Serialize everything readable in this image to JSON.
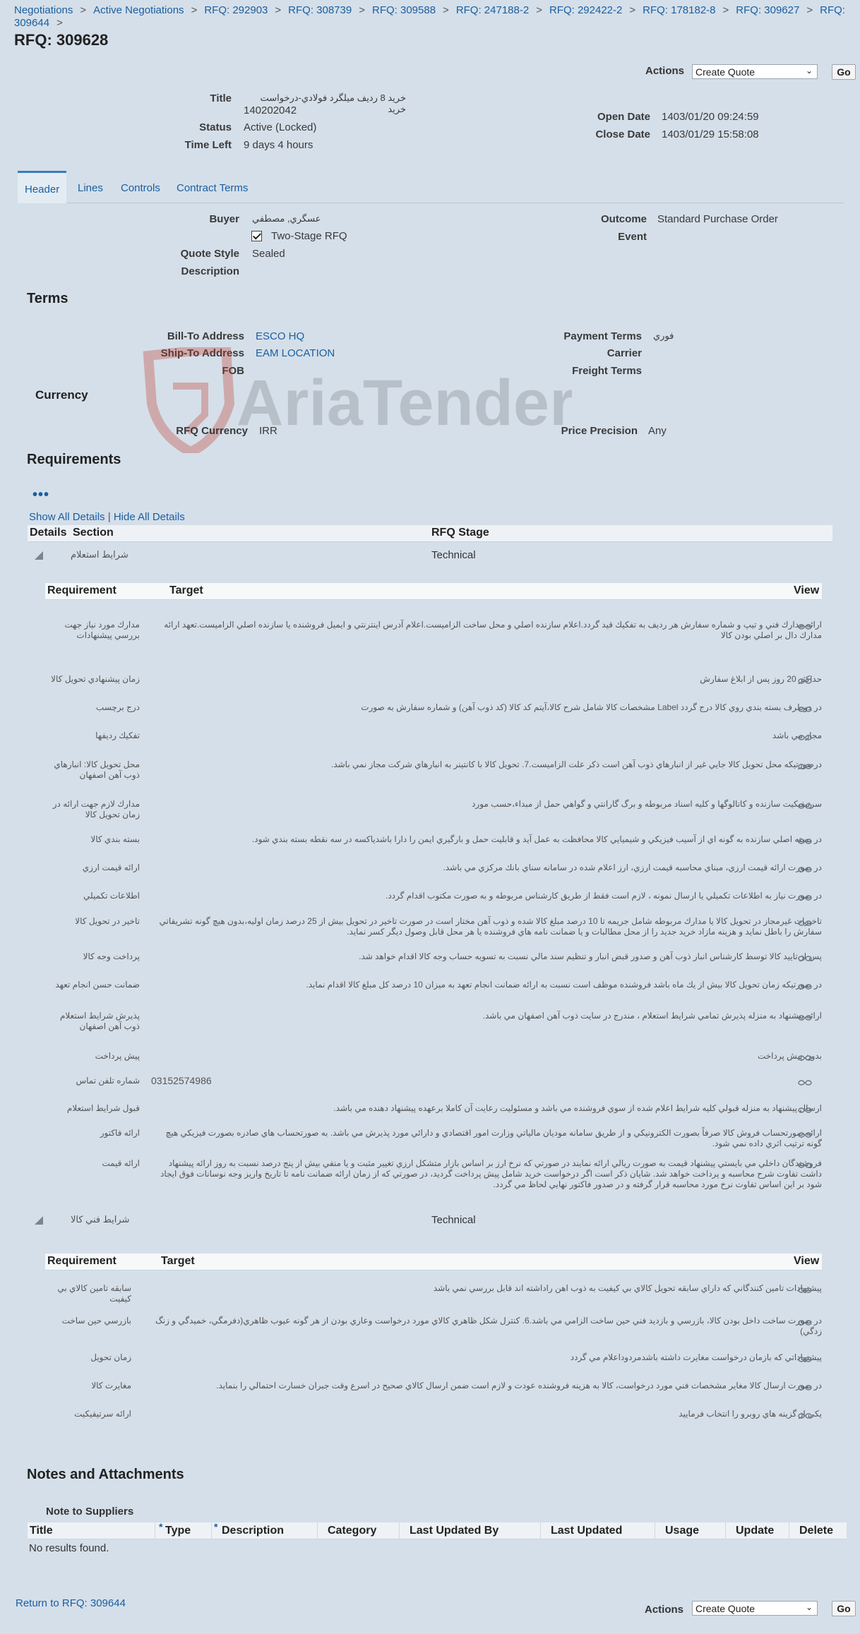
{
  "breadcrumbs": [
    "Negotiations",
    "Active Negotiations",
    "RFQ: 292903",
    "RFQ: 308739",
    "RFQ: 309588",
    "RFQ: 247188-2",
    "RFQ: 292422-2",
    "RFQ: 178182-8",
    "RFQ: 309627",
    "RFQ: 309644"
  ],
  "page_title": "RFQ: 309628",
  "actions": {
    "label": "Actions",
    "selected": "Create Quote",
    "go": "Go"
  },
  "summary": {
    "title_label": "Title",
    "title_value_line1": "خريد 8 رديف ميلگرد فولادي-درخواست خريد",
    "title_value_line2": "140202042",
    "status_label": "Status",
    "status_value": "Active (Locked)",
    "time_left_label": "Time Left",
    "time_left_value": "9 days 4 hours",
    "open_date_label": "Open Date",
    "open_date_value": "1403/01/20 09:24:59",
    "close_date_label": "Close Date",
    "close_date_value": "1403/01/29 15:58:08"
  },
  "tabs": [
    "Header",
    "Lines",
    "Controls",
    "Contract Terms"
  ],
  "header": {
    "buyer_label": "Buyer",
    "buyer_value": "عسگري, مصطفي",
    "two_stage_label": "Two-Stage RFQ",
    "quote_style_label": "Quote Style",
    "quote_style_value": "Sealed",
    "description_label": "Description",
    "outcome_label": "Outcome",
    "outcome_value": "Standard Purchase Order",
    "event_label": "Event"
  },
  "terms": {
    "heading": "Terms",
    "bill_to_label": "Bill-To Address",
    "bill_to_value": "ESCO HQ",
    "ship_to_label": "Ship-To Address",
    "ship_to_value": "EAM LOCATION",
    "fob_label": "FOB",
    "payment_terms_label": "Payment Terms",
    "payment_terms_value": "فوري",
    "carrier_label": "Carrier",
    "freight_terms_label": "Freight Terms"
  },
  "currency": {
    "heading": "Currency",
    "rfq_currency_label": "RFQ Currency",
    "rfq_currency_value": "IRR",
    "price_precision_label": "Price Precision",
    "price_precision_value": "Any"
  },
  "watermark_text": "AriaTender.neT",
  "requirements": {
    "heading": "Requirements",
    "show_all": "Show All Details",
    "divider": "|",
    "hide_all": "Hide All Details",
    "col_details": "Details",
    "col_section": "Section",
    "col_stage": "RFQ Stage",
    "col_requirement": "Requirement",
    "col_target": "Target",
    "col_view": "View",
    "sections": [
      {
        "name": "شرايط استعلام",
        "stage": "Technical",
        "rows": [
          {
            "req": "مدارك مورد نياز جهت بررسي پيشنهادات",
            "target": "ارائه مدارك فني و تيپ و شماره سفارش هر رديف به تفكيك قيد گردد.اعلام سازنده اصلي و محل ساخت الزاميست.اعلام آدرس اينترنتي و ايميل فروشنده يا سازنده اصلي الزاميست.تعهد ارائه مدارك دال بر اصلي بودن كالا"
          },
          {
            "req": "زمان پيشنهادي تحويل كالا",
            "target": "حداكثر 20 روز پس از ابلاغ سفارش"
          },
          {
            "req": "درج برچسب",
            "target": "در دوطرف بسته بندي روي كالا درج گردد Label مشخصات كالا شامل شرح كالا،آيتم كد كالا (كد ذوب آهن) و شماره سفارش به صورت"
          },
          {
            "req": "تفكيك رديفها",
            "target": "مجاز مي باشد"
          },
          {
            "req": "محل تحويل كالا: انبارهاي ذوب آهن اصفهان",
            "target": "درصورتيكه محل تحويل كالا جايي غير از انبارهاي ذوب آهن است ذكر علت الزاميست.7. تحويل كالا با كانتينر به انبارهاي شركت مجاز نمي باشد."
          },
          {
            "req": "مدارك لازم جهت ارائه در زمان تحويل كالا",
            "target": "سرتيفيكيت سازنده و كاتالوگها و كليه اسناد مربوطه و برگ گارانتي و گواهي حمل از مبداء،حسب مورد"
          },
          {
            "req": "بسته بندي كالا",
            "target": "در بسته اصلي سازنده به گونه اي از آسيب فيزيكي و شيميايي كالا محافظت به عمل آيد و قابليت حمل و بارگيري ايمن را دارا باشدياكسه در سه نقطه بسته بندي شود."
          },
          {
            "req": "ارائه قيمت ارزي",
            "target": "در صورت ارائه قيمت ارزي، مبناي محاسبه قيمت ارزي، ارز اعلام شده در سامانه سناي بانك مركزي مي باشد."
          },
          {
            "req": "اطلاعات تكميلي",
            "target": "در صورت نياز به اطلاعات تكميلي يا ارسال نمونه ، لازم است فقط از طريق كارشناس مربوطه و به صورت مكتوب اقدام گردد."
          },
          {
            "req": "تاخير در تحويل كالا",
            "target": "تاخيرات غيرمجاز در تحويل كالا يا مدارك مربوطه شامل جريمه تا 10 درصد مبلغ كالا شده و ذوب آهن مختار است در صورت تاخير در تحويل بيش از 25 درصد زمان اوليه،بدون هيچ گونه تشريفاتي سفارش را باطل نمايد و هزينه مازاد خريد جديد را از محل مطالبات و يا ضمانت نامه هاي فروشنده يا هر محل قابل وصول ديگر كسر نمايد."
          },
          {
            "req": "پرداخت وجه كالا",
            "target": "پس از تاييد كالا توسط كارشناس انبار ذوب آهن و صدور قبض انبار و تنظيم سند مالي نسبت به تسويه حساب وجه كالا اقدام خواهد شد."
          },
          {
            "req": "ضمانت حسن انجام تعهد",
            "target": "در صورتيكه زمان تحويل كالا بيش از يك ماه باشد فروشنده موظف است نسبت به ارائه ضمانت انجام تعهد به ميزان 10 درصد كل مبلغ كالا اقدام نمايد."
          },
          {
            "req": "پذيرش شرايط استعلام ذوب آهن اصفهان",
            "target": "ارائه پيشنهاد به منزله پذيرش تمامي شرايط استعلام ، مندرج در سايت ذوب آهن اصفهان مي باشد."
          },
          {
            "req": "پيش پرداخت",
            "target": "بدون پيش پرداخت"
          },
          {
            "req": "شماره تلفن تماس",
            "target": "03152574986"
          },
          {
            "req": "قبول شرايط استعلام",
            "target": "ارسال پيشنهاد به منزله قبولي كليه شرايط اعلام شده از سوي فروشنده مي باشد و مسئوليت رعايت آن كاملا برعهده پيشنهاد دهنده مي باشد."
          },
          {
            "req": "ارائه فاكتور",
            "target": "ارائه صورتحساب فروش كالا صرفاً بصورت الكترونيكي و از طريق سامانه موديان مالياتي وزارت امور اقتصادي و دارائي مورد پذيرش مي باشد. به صورتحساب هاي صادره بصورت فيزيكي هيچ گونه ترتيب اثري داده نمي شود."
          },
          {
            "req": "ارائه قيمت",
            "target": "فروشندگان داخلي مي بايستي پيشنهاد قيمت به صورت ريالي ارائه نمايند در صورتي كه نرخ ارز بر اساس بازار متشكل ارزي تغيير مثبت و يا منفي بيش از پنج درصد نسبت به روز ارائه پيشنهاد داشت تفاوت شرح محاسبه و پرداخت خواهد شد. شايان ذكر است اگر درخواست خريد شامل پيش پرداخت گرديد، در صورتي كه از زمان ارائه ضمانت نامه تا تاريخ واريز وجه نوسانات فوق ايجاد شود بر اين اساس تفاوت نرخ مورد محاسبه قرار گرفته و در صدور فاكتور نهايي لحاظ مي گردد."
          }
        ]
      },
      {
        "name": "شرايط فني كالا",
        "stage": "Technical",
        "rows": [
          {
            "req": "سابقه تامين كالاي بي كيفيت",
            "target": "پيشنهادات تامين كنندگاني كه داراي سابقه تحويل كالاي بي كيفيت به ذوب اهن راداشته اند قابل بررسي نمي باشد"
          },
          {
            "req": "بازرسي حين ساخت",
            "target": "در صورت ساخت داخل بودن كالا، بازرسي و بازديد فني حين ساخت الزامي مي باشد.6. كنترل شكل ظاهري كالاي مورد درخواست وعاري بودن از هر گونه عيوب ظاهري(دفرمگي، خميدگي و زنگ زدگي)"
          },
          {
            "req": "زمان تحويل",
            "target": "پيشنهاداتي كه بازمان درخواست مغايرت داشته باشدمردوداعلام مي گردد"
          },
          {
            "req": "مغايرت كالا",
            "target": "در صورت ارسال كالا مغاير مشخصات فني مورد درخواست، كالا به هزينه فروشنده عودت و لازم است ضمن ارسال كالاي صحيح در اسرع وقت جبران خسارت احتمالي را بنمايد."
          },
          {
            "req": "ارائه سرتيفيكيت",
            "target": "يكي از گزينه هاي روبرو را انتخاب فرماييد"
          }
        ]
      }
    ]
  },
  "notes": {
    "heading": "Notes and Attachments",
    "sub_heading": "Note to Suppliers",
    "columns": [
      "Title",
      "Type",
      "Description",
      "Category",
      "Last Updated By",
      "Last Updated",
      "Usage",
      "Update",
      "Delete"
    ],
    "required_marker": "*",
    "empty_text": "No results found."
  },
  "footer": {
    "return_link": "Return to RFQ: 309644"
  }
}
